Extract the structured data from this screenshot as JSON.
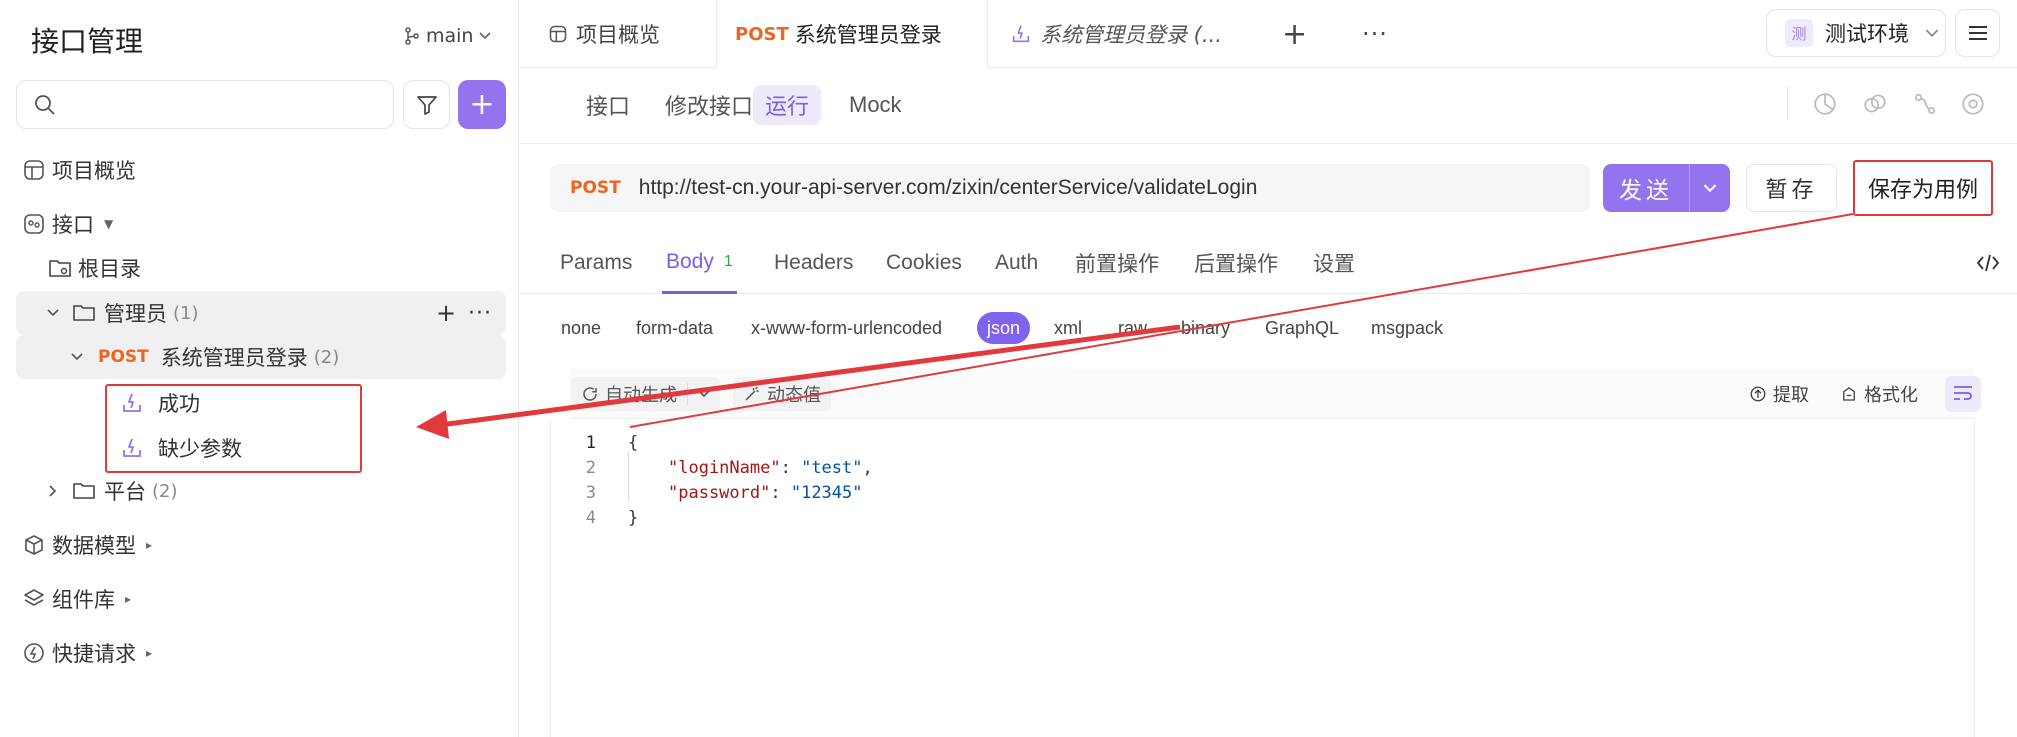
{
  "sidebar": {
    "title": "接口管理",
    "branch": "main",
    "search_placeholder": "",
    "tree": {
      "overview": "项目概览",
      "apis": "接口",
      "root": "根目录",
      "folder_admin": {
        "label": "管理员",
        "count": "(1)"
      },
      "endpoint": {
        "method": "POST",
        "label": "系统管理员登录",
        "count": "(2)"
      },
      "cases": [
        "成功",
        "缺少参数"
      ],
      "folder_platform": {
        "label": "平台",
        "count": "(2)"
      },
      "data_models": "数据模型",
      "components": "组件库",
      "quick_requests": "快捷请求"
    }
  },
  "tabs": {
    "overview": "项目概览",
    "active": {
      "method": "POST",
      "label": "系统管理员登录"
    },
    "case_tab": "系统管理员登录 (..."
  },
  "env": {
    "badge": "测",
    "label": "测试环境"
  },
  "subnav": [
    "接口",
    "修改接口",
    "运行",
    "Mock"
  ],
  "request": {
    "method": "POST",
    "url": "http://test-cn.your-api-server.com/zixin/centerService/validateLogin",
    "send": "发送",
    "draft": "暂存",
    "save_case": "保存为用例"
  },
  "req_tabs": {
    "params": "Params",
    "body": "Body",
    "body_count": "1",
    "headers": "Headers",
    "cookies": "Cookies",
    "auth": "Auth",
    "pre": "前置操作",
    "post": "后置操作",
    "settings": "设置"
  },
  "body_types": [
    "none",
    "form-data",
    "x-www-form-urlencoded",
    "json",
    "xml",
    "raw",
    "binary",
    "GraphQL",
    "msgpack"
  ],
  "editor_toolbar": {
    "auto_gen": "自动生成",
    "dynamic": "动态值",
    "extract": "提取",
    "format": "格式化"
  },
  "code": {
    "line_numbers": [
      "1",
      "2",
      "3",
      "4"
    ],
    "line1": "{",
    "line2_key": "\"loginName\"",
    "line2_val": "\"test\"",
    "line3_key": "\"password\"",
    "line3_val": "\"12345\"",
    "line4": "}"
  },
  "colors": {
    "accent": "#9373ee",
    "method_post": "#f06420",
    "annotation_red": "#e2393c"
  }
}
